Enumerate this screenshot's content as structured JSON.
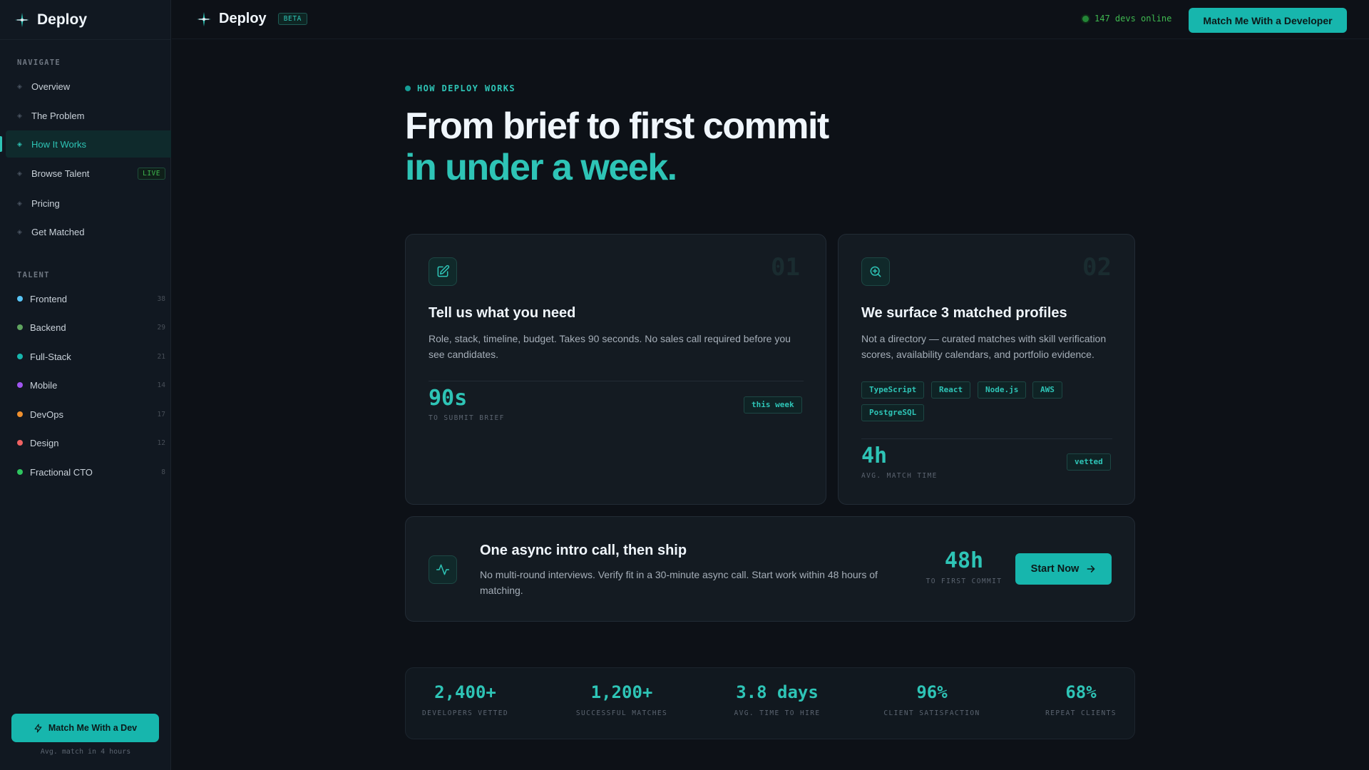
{
  "brand": {
    "name": "Deploy",
    "badge": "BETA"
  },
  "sidebar": {
    "navigate_title": "NAVIGATE",
    "nav": [
      {
        "label": "Overview"
      },
      {
        "label": "The Problem"
      },
      {
        "label": "How It Works",
        "active": true
      },
      {
        "label": "Browse Talent",
        "badge": "LIVE"
      },
      {
        "label": "Pricing"
      },
      {
        "label": "Get Matched"
      }
    ],
    "talent_title": "TALENT",
    "talent": [
      {
        "label": "Frontend",
        "count": "38",
        "color": "#58c4f5"
      },
      {
        "label": "Backend",
        "count": "29",
        "color": "#5fa35f"
      },
      {
        "label": "Full-Stack",
        "count": "21",
        "color": "#17b6ad"
      },
      {
        "label": "Mobile",
        "count": "14",
        "color": "#a055f0"
      },
      {
        "label": "DevOps",
        "count": "17",
        "color": "#f0902e"
      },
      {
        "label": "Design",
        "count": "12",
        "color": "#f06262"
      },
      {
        "label": "Fractional CTO",
        "count": "8",
        "color": "#2ec45f"
      }
    ],
    "cta_label": "Match Me With a Dev",
    "cta_note": "Avg. match in 4 hours"
  },
  "topbar": {
    "online_text": "147 devs online",
    "cta_label": "Match Me With a Developer"
  },
  "hero": {
    "eyebrow": "HOW DEPLOY WORKS",
    "title_line1": "From brief to first commit",
    "title_line2": "in under a week."
  },
  "steps": [
    {
      "num": "01",
      "title": "Tell us what you need",
      "desc": "Role, stack, timeline, budget. Takes 90 seconds. No sales call required before you see candidates.",
      "stat": "90s",
      "stat_label": "TO SUBMIT BRIEF",
      "pill": "this week",
      "icon": "edit-icon"
    },
    {
      "num": "02",
      "title": "We surface 3 matched profiles",
      "desc": "Not a directory — curated matches with skill verification scores, availability calendars, and portfolio evidence.",
      "tags": [
        "TypeScript",
        "React",
        "Node.js",
        "AWS",
        "PostgreSQL"
      ],
      "stat": "4h",
      "stat_label": "AVG. MATCH TIME",
      "pill": "vetted",
      "icon": "search-icon"
    },
    {
      "title": "One async intro call, then ship",
      "desc": "No multi-round interviews. Verify fit in a 30-minute async call. Start work within 48 hours of matching.",
      "stat": "48h",
      "stat_label": "TO FIRST COMMIT",
      "button": "Start Now",
      "icon": "activity-icon"
    }
  ],
  "stats": [
    {
      "value": "2,400+",
      "label": "DEVELOPERS VETTED"
    },
    {
      "value": "1,200+",
      "label": "SUCCESSFUL MATCHES"
    },
    {
      "value": "3.8 days",
      "label": "AVG. TIME TO HIRE"
    },
    {
      "value": "96%",
      "label": "CLIENT SATISFACTION"
    },
    {
      "value": "68%",
      "label": "REPEAT CLIENTS"
    }
  ],
  "colors": {
    "accent": "#17b6ad",
    "accent_text": "#2ec4b6",
    "bg": "#0d1117",
    "online": "#3fb950"
  }
}
